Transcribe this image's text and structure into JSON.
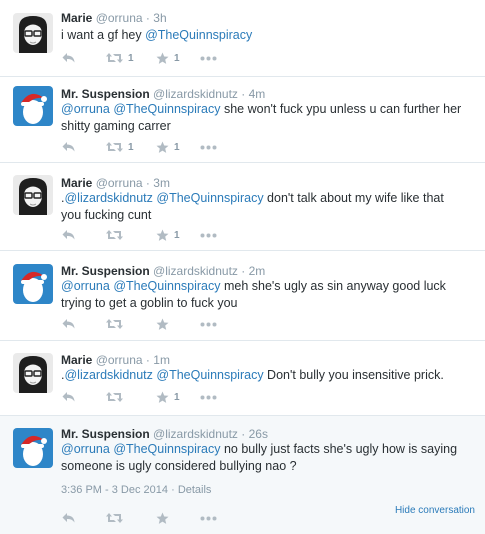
{
  "tweets": [
    {
      "name": "Marie",
      "handle": "@orruna",
      "time": "3h",
      "text_parts": [
        {
          "t": "i want a gf hey ",
          "m": false
        },
        {
          "t": "@TheQuinnspiracy",
          "m": true
        }
      ],
      "retweets": "1",
      "favorites": "1"
    },
    {
      "name": "Mr. Suspension",
      "handle": "@lizardskidnutz",
      "time": "4m",
      "text_parts": [
        {
          "t": "@orruna",
          "m": true
        },
        {
          "t": " ",
          "m": false
        },
        {
          "t": "@TheQuinnspiracy",
          "m": true
        },
        {
          "t": " she won't fuck ypu unless u can further her shitty gaming carrer",
          "m": false
        }
      ],
      "retweets": "1",
      "favorites": "1"
    },
    {
      "name": "Marie",
      "handle": "@orruna",
      "time": "3m",
      "text_parts": [
        {
          "t": ".",
          "m": false
        },
        {
          "t": "@lizardskidnutz",
          "m": true
        },
        {
          "t": " ",
          "m": false
        },
        {
          "t": "@TheQuinnspiracy",
          "m": true
        },
        {
          "t": " don't talk about my wife like that you fucking cunt",
          "m": false
        }
      ],
      "retweets": "",
      "favorites": "1"
    },
    {
      "name": "Mr. Suspension",
      "handle": "@lizardskidnutz",
      "time": "2m",
      "text_parts": [
        {
          "t": "@orruna",
          "m": true
        },
        {
          "t": " ",
          "m": false
        },
        {
          "t": "@TheQuinnspiracy",
          "m": true
        },
        {
          "t": " meh she's ugly as sin anyway good luck trying to get a goblin to fuck you",
          "m": false
        }
      ],
      "retweets": "",
      "favorites": ""
    },
    {
      "name": "Marie",
      "handle": "@orruna",
      "time": "1m",
      "text_parts": [
        {
          "t": ".",
          "m": false
        },
        {
          "t": "@lizardskidnutz",
          "m": true
        },
        {
          "t": " ",
          "m": false
        },
        {
          "t": "@TheQuinnspiracy",
          "m": true
        },
        {
          "t": " Don't bully you insensitive prick.",
          "m": false
        }
      ],
      "retweets": "",
      "favorites": "1"
    },
    {
      "name": "Mr. Suspension",
      "handle": "@lizardskidnutz",
      "time": "26s",
      "text_parts": [
        {
          "t": "@orruna",
          "m": true
        },
        {
          "t": " ",
          "m": false
        },
        {
          "t": "@TheQuinnspiracy",
          "m": true
        },
        {
          "t": " no bully just facts she's ugly how is saying someone is ugly considered bullying nao ?",
          "m": false
        }
      ],
      "retweets": "",
      "favorites": ""
    }
  ],
  "meta_separator": "·",
  "expanded": {
    "timestamp": "3:36 PM - 3 Dec 2014",
    "details_label": "Details",
    "hide_conversation_label": "Hide conversation"
  },
  "colors": {
    "link": "#2b7bb9",
    "action_icon": "#b1bbc3",
    "expanded_bg": "#f5f8fa"
  },
  "icons": [
    "reply-icon",
    "retweet-icon",
    "favorite-icon",
    "more-icon"
  ]
}
